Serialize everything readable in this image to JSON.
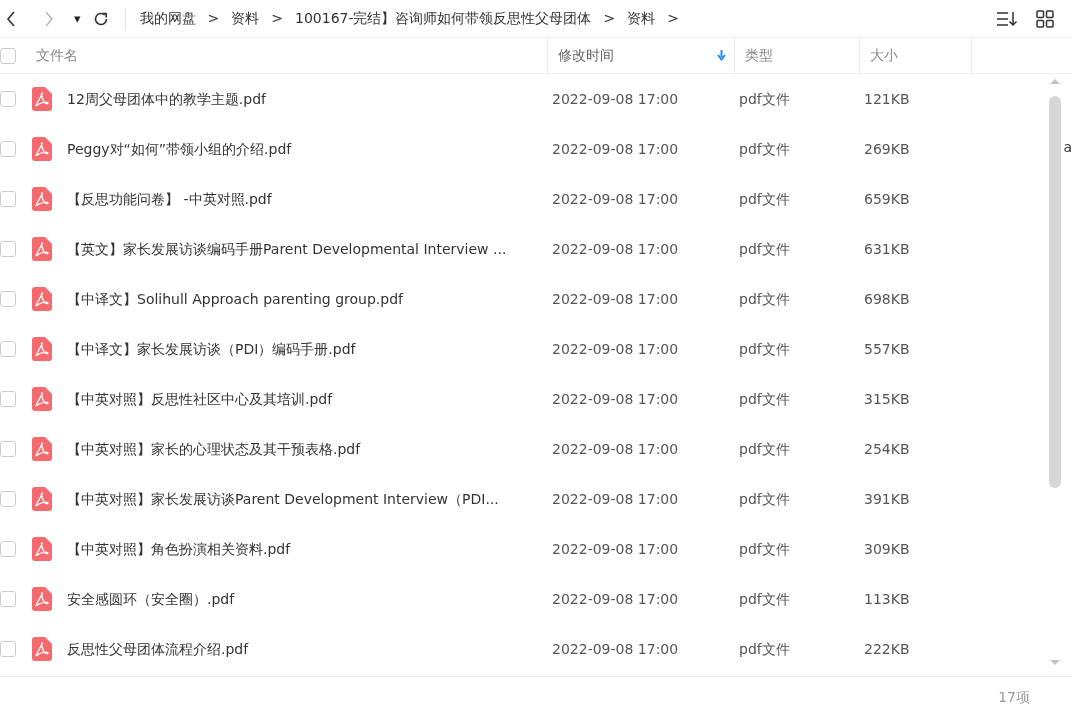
{
  "toolbar": {
    "dropdown_glyph": "▾",
    "breadcrumbs": [
      "我的网盘",
      "资料",
      "100167-完结】咨询师如何带领反思性父母团体",
      "资料"
    ],
    "separator": ">"
  },
  "table": {
    "select_all": {
      "checked": false
    },
    "columns": [
      {
        "label": "文件名",
        "sorted": false
      },
      {
        "label": "修改时间",
        "sorted": true
      },
      {
        "label": "类型",
        "sorted": false
      },
      {
        "label": "大小",
        "sorted": false
      }
    ],
    "rows": [
      {
        "checked": false,
        "name": "12周父母团体中的教学主题.pdf",
        "modified": "2022-09-08 17:00",
        "type": "pdf文件",
        "size": "121KB"
      },
      {
        "checked": false,
        "name": "Peggy对“如何”带领小组的介绍.pdf",
        "modified": "2022-09-08 17:00",
        "type": "pdf文件",
        "size": "269KB"
      },
      {
        "checked": false,
        "name": "【反思功能问卷】 -中英对照.pdf",
        "modified": "2022-09-08 17:00",
        "type": "pdf文件",
        "size": "659KB"
      },
      {
        "checked": false,
        "name": "【英文】家长发展访谈编码手册Parent Developmental Interview ...",
        "modified": "2022-09-08 17:00",
        "type": "pdf文件",
        "size": "631KB"
      },
      {
        "checked": false,
        "name": "【中译文】Solihull Approach parenting group.pdf",
        "modified": "2022-09-08 17:00",
        "type": "pdf文件",
        "size": "698KB"
      },
      {
        "checked": false,
        "name": "【中译文】家长发展访谈（PDI）编码手册.pdf",
        "modified": "2022-09-08 17:00",
        "type": "pdf文件",
        "size": "557KB"
      },
      {
        "checked": false,
        "name": "【中英对照】反思性社区中心及其培训.pdf",
        "modified": "2022-09-08 17:00",
        "type": "pdf文件",
        "size": "315KB"
      },
      {
        "checked": false,
        "name": "【中英对照】家长的心理状态及其干预表格.pdf",
        "modified": "2022-09-08 17:00",
        "type": "pdf文件",
        "size": "254KB"
      },
      {
        "checked": false,
        "name": "【中英对照】家长发展访谈Parent Development Interview（PDI...",
        "modified": "2022-09-08 17:00",
        "type": "pdf文件",
        "size": "391KB"
      },
      {
        "checked": false,
        "name": "【中英对照】角色扮演相关资料.pdf",
        "modified": "2022-09-08 17:00",
        "type": "pdf文件",
        "size": "309KB"
      },
      {
        "checked": false,
        "name": "安全感圆环（安全圈）.pdf",
        "modified": "2022-09-08 17:00",
        "type": "pdf文件",
        "size": "113KB"
      },
      {
        "checked": false,
        "name": "反思性父母团体流程介绍.pdf",
        "modified": "2022-09-08 17:00",
        "type": "pdf文件",
        "size": "222KB"
      }
    ]
  },
  "edge_fragment": "a",
  "status_bar": {
    "count": "17项"
  }
}
